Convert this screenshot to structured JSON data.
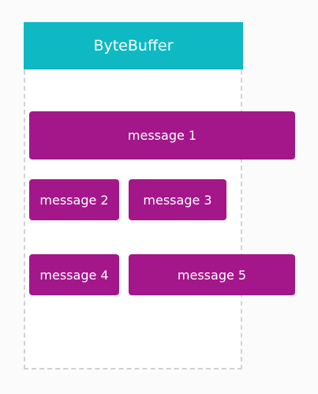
{
  "buffer": {
    "title": "ByteBuffer",
    "header_color": "#0fb9c4",
    "border_color": "#d2d2d2"
  },
  "message_color": "#a3178b",
  "messages": [
    {
      "label": "message 1"
    },
    {
      "label": "message 2"
    },
    {
      "label": "message 3"
    },
    {
      "label": "message 4"
    },
    {
      "label": "message 5"
    }
  ]
}
